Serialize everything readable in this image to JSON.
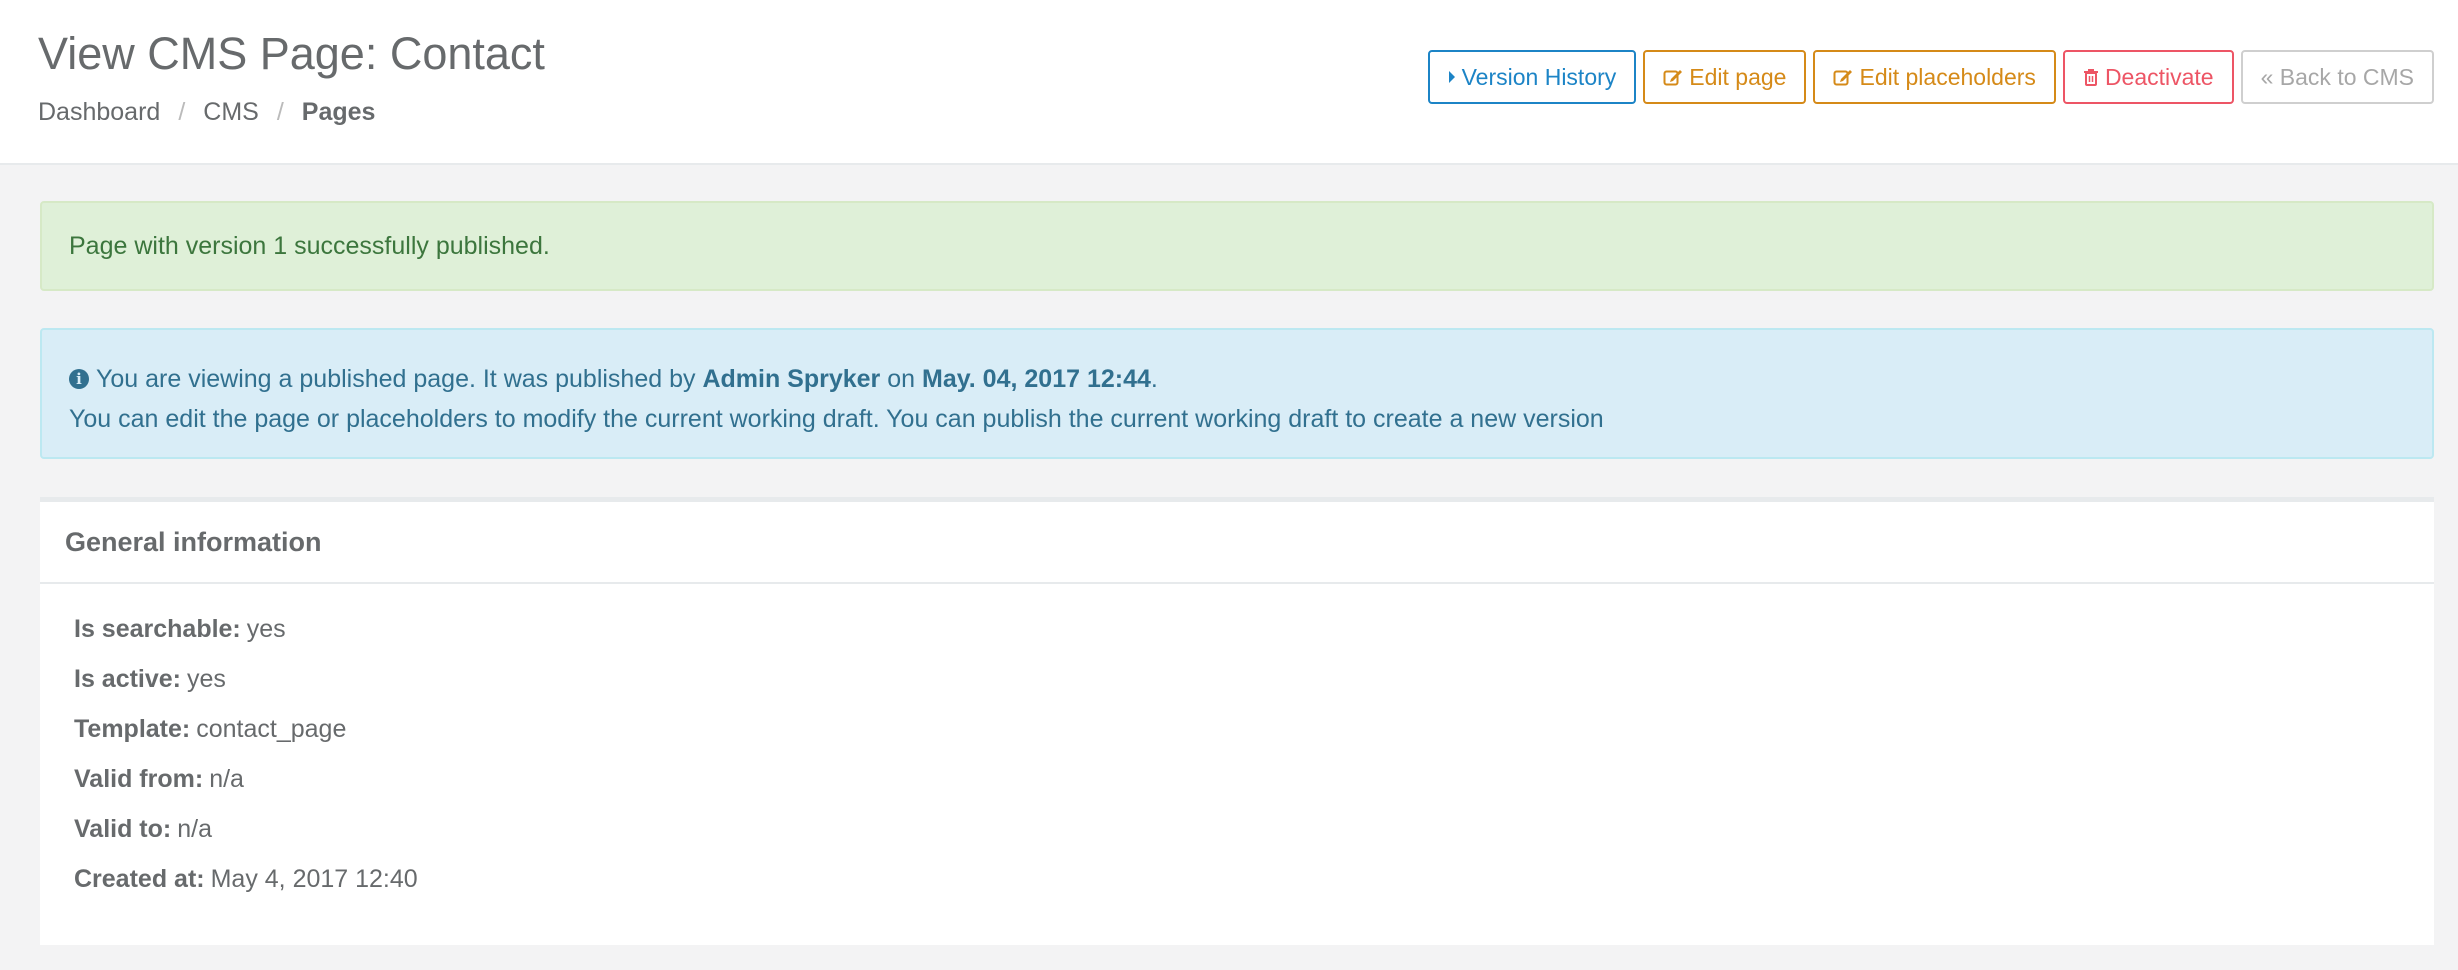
{
  "header": {
    "title": "View CMS Page: Contact",
    "breadcrumb": [
      {
        "label": "Dashboard"
      },
      {
        "label": "CMS"
      },
      {
        "label": "Pages"
      }
    ],
    "breadcrumb_separator": "/"
  },
  "actions": {
    "version_history": "Version History",
    "edit_page": "Edit page",
    "edit_placeholders": "Edit placeholders",
    "deactivate": "Deactivate",
    "back_to_cms": "« Back to CMS"
  },
  "alerts": {
    "success": "Page with version 1 successfully published.",
    "info": {
      "prefix": "You are viewing a published page. It was published by",
      "author": "Admin Spryker",
      "on": "on",
      "date": "May. 04, 2017 12:44",
      "suffix": ".",
      "line2": "You can edit the page or placeholders to modify the current working draft. You can publish the current working draft to create a new version"
    }
  },
  "panel": {
    "title": "General information",
    "rows": [
      {
        "key": "Is searchable:",
        "value": "yes"
      },
      {
        "key": "Is active:",
        "value": "yes"
      },
      {
        "key": "Template:",
        "value": "contact_page"
      },
      {
        "key": "Valid from:",
        "value": "n/a"
      },
      {
        "key": "Valid to:",
        "value": "n/a"
      },
      {
        "key": "Created at:",
        "value": "May 4, 2017 12:40"
      }
    ]
  },
  "colors": {
    "primary": "#1c84c6",
    "warning": "#d58a18",
    "danger": "#ed5565",
    "success_bg": "#dff0d8",
    "info_bg": "#d9edf7"
  },
  "icons": {
    "version_history": "caret-right-icon",
    "edit_page": "edit-icon",
    "edit_placeholders": "edit-icon",
    "deactivate": "trash-icon",
    "info": "info-circle-icon"
  }
}
